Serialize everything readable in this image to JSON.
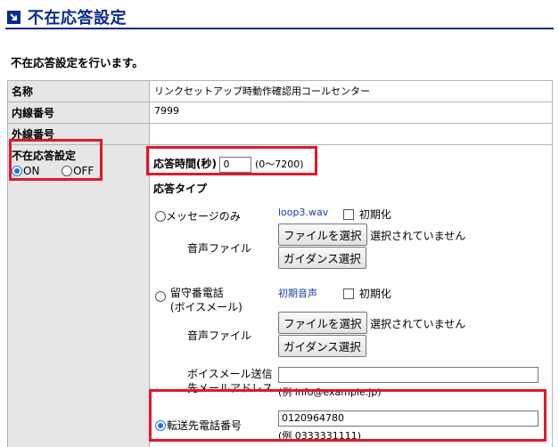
{
  "page": {
    "title": "不在応答設定",
    "intro": "不在応答設定を行います。"
  },
  "rows": {
    "name": {
      "label": "名称",
      "value": "リンクセットアップ時動作確認用コールセンター"
    },
    "extension": {
      "label": "内線番号",
      "value": "7999"
    },
    "external": {
      "label": "外線番号",
      "value": ""
    },
    "absence": {
      "label": "不在応答設定",
      "on_label": "ON",
      "off_label": "OFF",
      "selected": "ON"
    }
  },
  "response_time": {
    "label": "応答時間(秒)",
    "value": "0",
    "range": "(0〜7200)"
  },
  "response_type": {
    "label": "応答タイプ",
    "message_only": {
      "label": "メッセージのみ",
      "file_name": "loop3.wav",
      "reset_label": "初期化",
      "audio_label": "音声ファイル",
      "file_button": "ファイルを選択",
      "file_status": "選択されていません",
      "guidance_button": "ガイダンス選択"
    },
    "voicemail": {
      "label_line1": "留守番電話",
      "label_line2": "(ボイスメール)",
      "file_name": "初期音声",
      "reset_label": "初期化",
      "audio_label": "音声ファイル",
      "file_button": "ファイルを選択",
      "file_status": "選択されていません",
      "guidance_button": "ガイダンス選択",
      "email_label_line1": "ボイスメール送信",
      "email_label_line2": "先メールアドレス",
      "email_value": "",
      "email_example": "(例 info@example.jp)"
    },
    "forward": {
      "label": "転送先電話番号",
      "value": "0120964780",
      "example": "(例 0333331111)",
      "selected": true
    }
  },
  "colors": {
    "accent": "#0b2a8c",
    "highlight": "#e3172a",
    "label_bg": "#e6e6e6"
  }
}
